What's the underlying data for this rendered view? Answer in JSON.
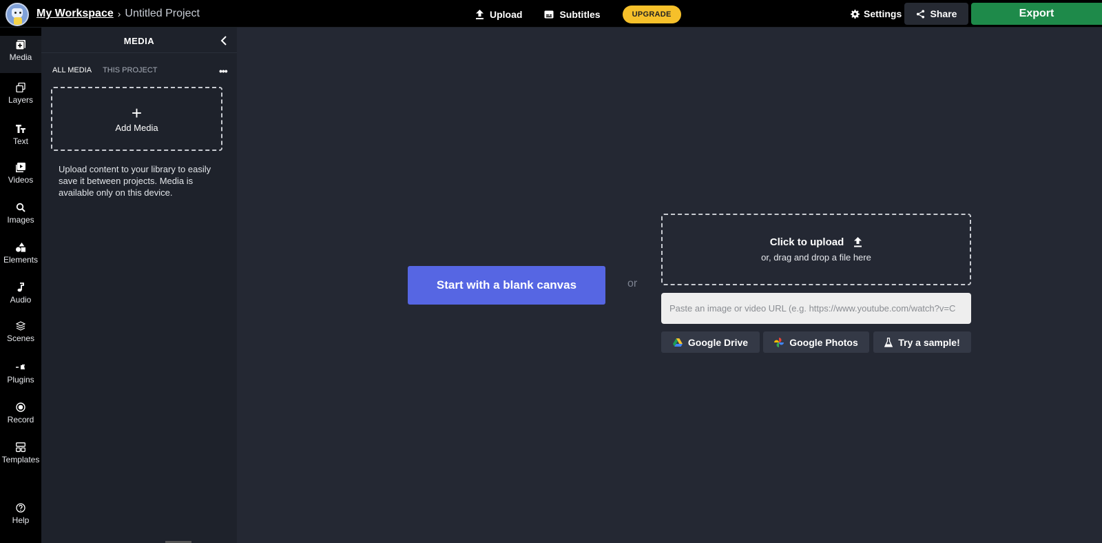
{
  "header": {
    "workspace": "My Workspace",
    "separator": "›",
    "project": "Untitled Project",
    "upload": "Upload",
    "subtitles": "Subtitles",
    "upgrade": "UPGRADE",
    "settings": "Settings",
    "share": "Share",
    "export": "Export"
  },
  "rail": [
    {
      "label": "Media",
      "icon": "media-plus-icon"
    },
    {
      "label": "Layers",
      "icon": "layers-icon"
    },
    {
      "label": "Text",
      "icon": "text-icon"
    },
    {
      "label": "Videos",
      "icon": "video-icon"
    },
    {
      "label": "Images",
      "icon": "search-icon"
    },
    {
      "label": "Elements",
      "icon": "shapes-icon"
    },
    {
      "label": "Audio",
      "icon": "music-note-icon"
    },
    {
      "label": "Scenes",
      "icon": "stack-icon"
    },
    {
      "label": "Plugins",
      "icon": "plug-icon"
    },
    {
      "label": "Record",
      "icon": "record-icon"
    },
    {
      "label": "Templates",
      "icon": "templates-icon"
    },
    {
      "label": "Help",
      "icon": "help-icon"
    }
  ],
  "panel": {
    "title": "MEDIA",
    "tab_all": "ALL MEDIA",
    "tab_project": "THIS PROJECT",
    "more": "•••",
    "add_plus": "+",
    "add_label": "Add Media",
    "note": "Upload content to your library to easily save it between projects. Media is available only on this device."
  },
  "main": {
    "blank_canvas": "Start with a blank canvas",
    "or": "or",
    "click_upload": "Click to upload",
    "drag_drop": "or, drag and drop a file here",
    "url_placeholder": "Paste an image or video URL (e.g. https://www.youtube.com/watch?v=C",
    "google_drive": "Google Drive",
    "google_photos": "Google Photos",
    "try_sample": "Try a sample!"
  },
  "colors": {
    "accent": "#5666e3",
    "export": "#1e8a4a",
    "upgrade": "#f6c02a"
  }
}
